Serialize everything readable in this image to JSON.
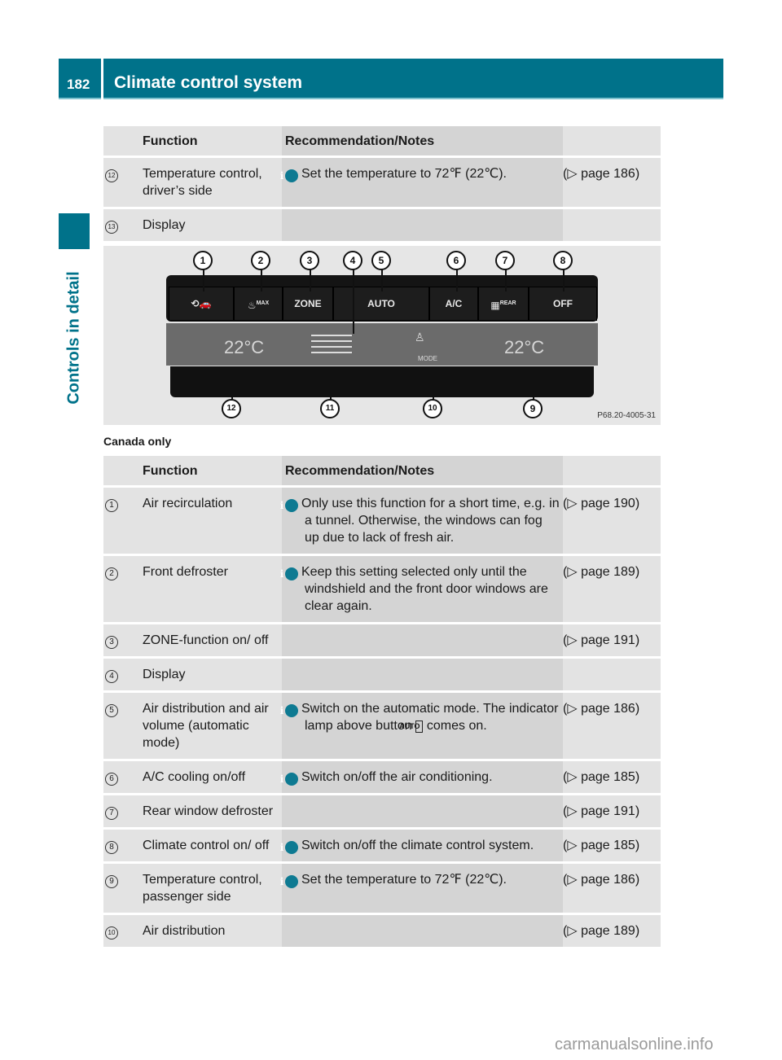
{
  "header": {
    "page_number": "182",
    "title": "Climate control system"
  },
  "sidebar": {
    "section": "Controls in detail"
  },
  "table1": {
    "headers": {
      "function": "Function",
      "notes": "Recommendation/Notes"
    },
    "rows": [
      {
        "num": "12",
        "function": "Temperature control, driver’s side",
        "note": "Set the temperature to 72℉ (22℃).",
        "page": "(▷ page 186)"
      },
      {
        "num": "13",
        "function": "Display",
        "note": "",
        "page": ""
      }
    ]
  },
  "figure": {
    "reference": "P68.20-4005-31",
    "buttons": [
      "",
      "MAX",
      "ZONE",
      "AUTO",
      "A/C",
      "REAR",
      "OFF"
    ],
    "display": {
      "left_temp": "22°C",
      "right_temp": "22°C",
      "mode_label": "MODE"
    },
    "callouts_top": [
      "1",
      "2",
      "3",
      "4",
      "5",
      "6",
      "7",
      "8"
    ],
    "callouts_bottom": [
      "12",
      "11",
      "10",
      "9"
    ]
  },
  "caption": "Canada only",
  "table2": {
    "headers": {
      "function": "Function",
      "notes": "Recommendation/Notes"
    },
    "rows": [
      {
        "num": "1",
        "function": "Air recirculation",
        "note": "Only use this function for a short time, e.g. in a tunnel. Otherwise, the windows can fog up due to lack of fresh air.",
        "page": "(▷ page 190)"
      },
      {
        "num": "2",
        "function": "Front defroster",
        "note": "Keep this setting selected only until the windshield and the front door windows are clear again.",
        "page": "(▷ page 189)"
      },
      {
        "num": "3",
        "function": "ZONE-function on/ off",
        "note": "",
        "page": "(▷ page 191)"
      },
      {
        "num": "4",
        "function": "Display",
        "note": "",
        "page": ""
      },
      {
        "num": "5",
        "function": "Air distribution and air volume (automatic mode)",
        "note_pre": "Switch on the automatic mode. The indicator lamp above button",
        "note_key": "AUTO",
        "note_post": "comes on.",
        "page": "(▷ page 186)"
      },
      {
        "num": "6",
        "function": "A/C cooling on/off",
        "note": "Switch on/off the air conditioning.",
        "page": "(▷ page 185)"
      },
      {
        "num": "7",
        "function": "Rear window defroster",
        "note": "",
        "page": "(▷ page 191)"
      },
      {
        "num": "8",
        "function": "Climate control on/ off",
        "note": "Switch on/off the climate control system.",
        "page": "(▷ page 185)"
      },
      {
        "num": "9",
        "function": "Temperature control, passenger side",
        "note": "Set the temperature to 72℉ (22℃).",
        "page": "(▷ page 186)"
      },
      {
        "num": "10",
        "function": "Air distribution",
        "note": "",
        "page": "(▷ page 189)"
      }
    ]
  },
  "watermark": "carmanualsonline.info",
  "colors": {
    "brand": "#00728a",
    "info_icon": "#0e7a92"
  }
}
